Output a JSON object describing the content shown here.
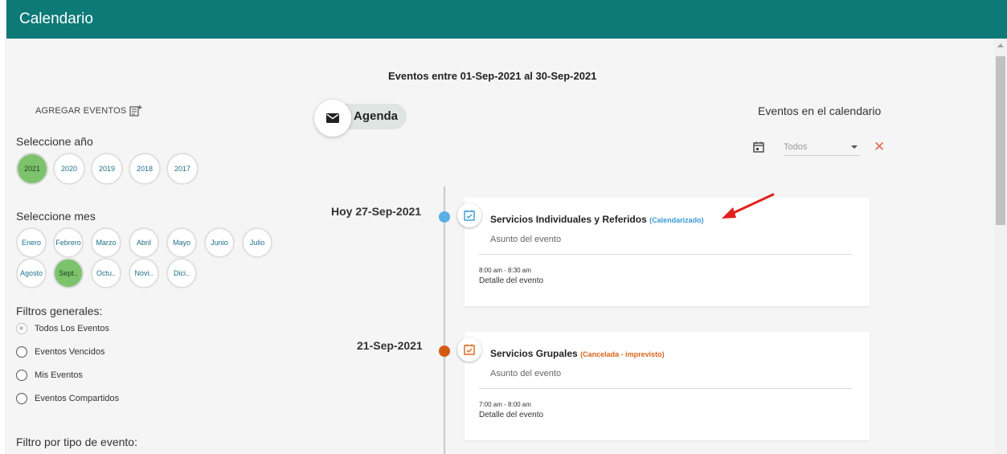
{
  "app": {
    "title": "Calendario"
  },
  "header": {
    "range_title": "Eventos entre 01-Sep-2021 al 30-Sep-2021"
  },
  "left": {
    "add_events_label": "AGREGAR EVENTOS",
    "year_label": "Seleccione año",
    "years": [
      {
        "label": "2021",
        "active": true
      },
      {
        "label": "2020",
        "active": false
      },
      {
        "label": "2019",
        "active": false
      },
      {
        "label": "2018",
        "active": false
      },
      {
        "label": "2017",
        "active": false
      }
    ],
    "month_label": "Seleccione mes",
    "months": [
      {
        "label": "Enero",
        "active": false
      },
      {
        "label": "Febrero",
        "active": false
      },
      {
        "label": "Marzo",
        "active": false
      },
      {
        "label": "Abril",
        "active": false
      },
      {
        "label": "Mayo",
        "active": false
      },
      {
        "label": "Junio",
        "active": false
      },
      {
        "label": "Julio",
        "active": false
      },
      {
        "label": "Agosto",
        "active": false
      },
      {
        "label": "Sept..",
        "active": true
      },
      {
        "label": "Octu..",
        "active": false
      },
      {
        "label": "Novi..",
        "active": false
      },
      {
        "label": "Dici..",
        "active": false
      }
    ],
    "filters_label": "Filtros generales:",
    "filters": [
      {
        "label": "Todos Los Eventos",
        "checked": true
      },
      {
        "label": "Eventos Vencidos",
        "checked": false
      },
      {
        "label": "Mis Eventos",
        "checked": false
      },
      {
        "label": "Eventos Compartidos",
        "checked": false
      }
    ],
    "type_filter_label": "Filtro por tipo de evento:"
  },
  "agenda": {
    "label": "Agenda",
    "icon": "mail-icon"
  },
  "right": {
    "events_in_calendar": "Eventos en el calendario",
    "select_value": "Todos",
    "icon": "calendar-icon"
  },
  "timeline": {
    "events": [
      {
        "date": "Hoy 27-Sep-2021",
        "title": "Servicios Individuales y Referidos",
        "status": "(Calendarizado)",
        "status_color": "#3a9ad9",
        "dot_color": "#5aaee5",
        "icon_color": "#3a9ad9",
        "subject": "Asunto del evento",
        "time": "8:00 am - 8:30 am",
        "detail": "Detalle del evento"
      },
      {
        "date": "21-Sep-2021",
        "title": "Servicios Grupales",
        "status": "(Cancelada - imprevisto)",
        "status_color": "#d9641a",
        "dot_color": "#d45a12",
        "icon_color": "#d9641a",
        "subject": "Asunto del evento",
        "time": "7:00 am - 8:00 am",
        "detail": "Detalle del evento"
      }
    ]
  },
  "colors": {
    "header": "#0e7a78",
    "active_pill": "#7cc36c",
    "annotation_arrow": "#e0201c"
  }
}
